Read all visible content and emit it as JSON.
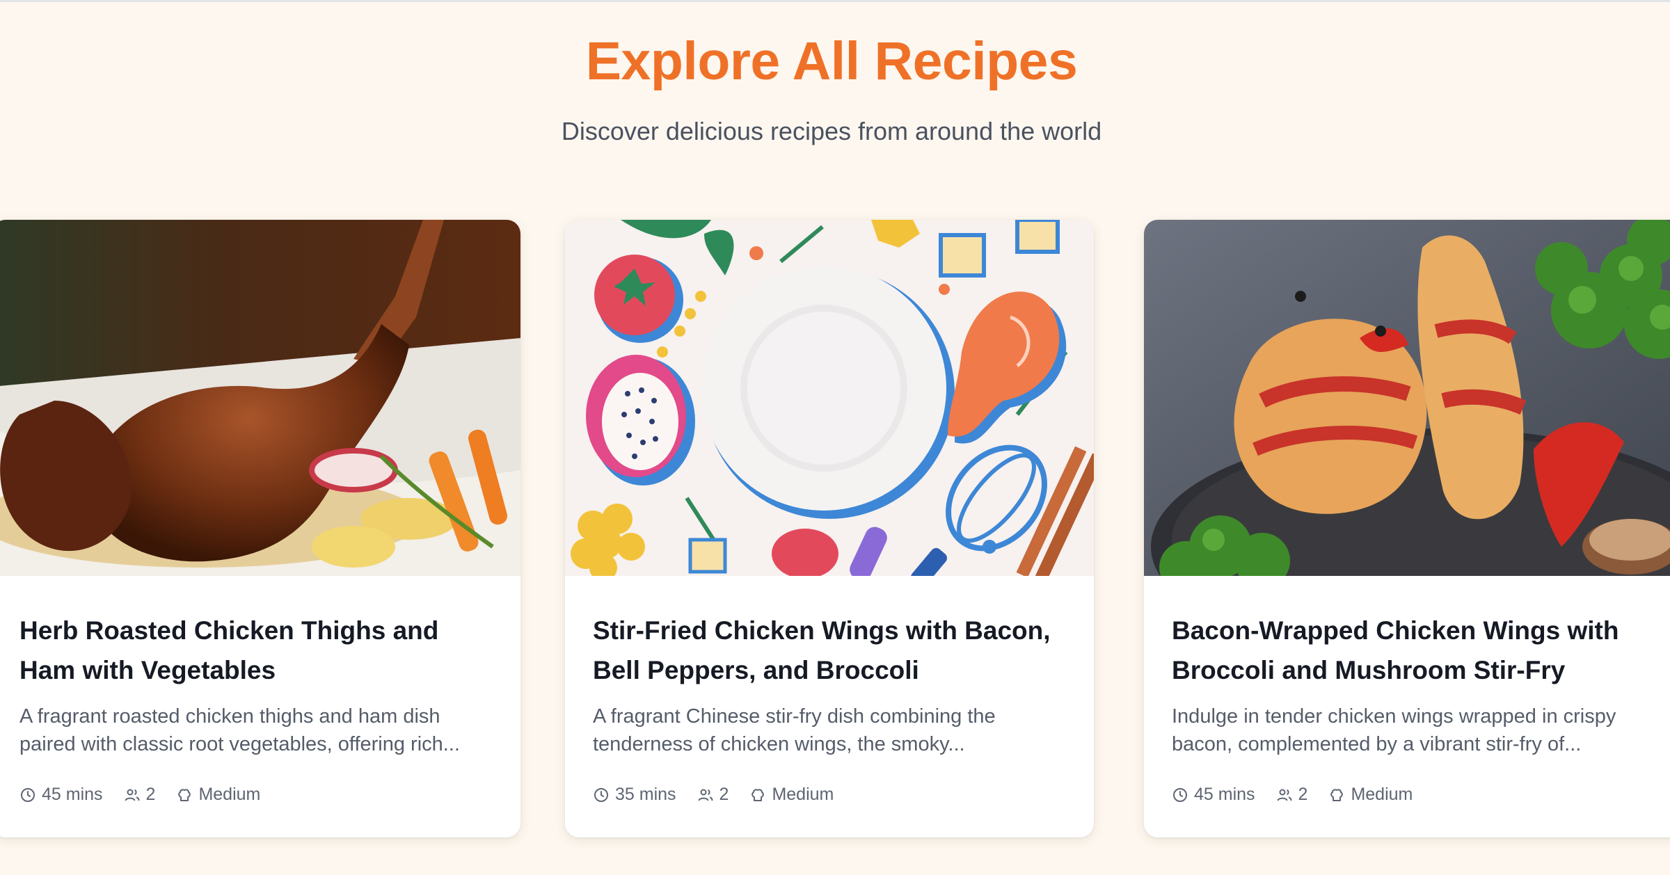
{
  "page": {
    "title": "Explore All Recipes",
    "subtitle": "Discover delicious recipes from around the world"
  },
  "recipes": [
    {
      "title": "Herb Roasted Chicken Thighs and Ham with Vegetables",
      "description": "A fragrant roasted chicken thighs and ham dish paired with classic root vegetables, offering rich...",
      "time": "45 mins",
      "servings": "2",
      "difficulty": "Medium",
      "image": "roasted-chicken-photo"
    },
    {
      "title": "Stir-Fried Chicken Wings with Bacon, Bell Peppers, and Broccoli",
      "description": "A fragrant Chinese stir-fry dish combining the tenderness of chicken wings, the smoky...",
      "time": "35 mins",
      "servings": "2",
      "difficulty": "Medium",
      "image": "placeholder-food-illustration"
    },
    {
      "title": "Bacon-Wrapped Chicken Wings with Broccoli and Mushroom Stir-Fry",
      "description": "Indulge in tender chicken wings wrapped in crispy bacon, complemented by a vibrant stir-fry of...",
      "time": "45 mins",
      "servings": "2",
      "difficulty": "Medium",
      "image": "bacon-wrapped-wings-photo"
    }
  ],
  "icons": {
    "time": "clock-icon",
    "servings": "users-icon",
    "difficulty": "chef-hat-icon"
  },
  "colors": {
    "accent": "#ef7128",
    "background": "#fdf7ef",
    "title": "#151a24",
    "text": "#555c69"
  }
}
